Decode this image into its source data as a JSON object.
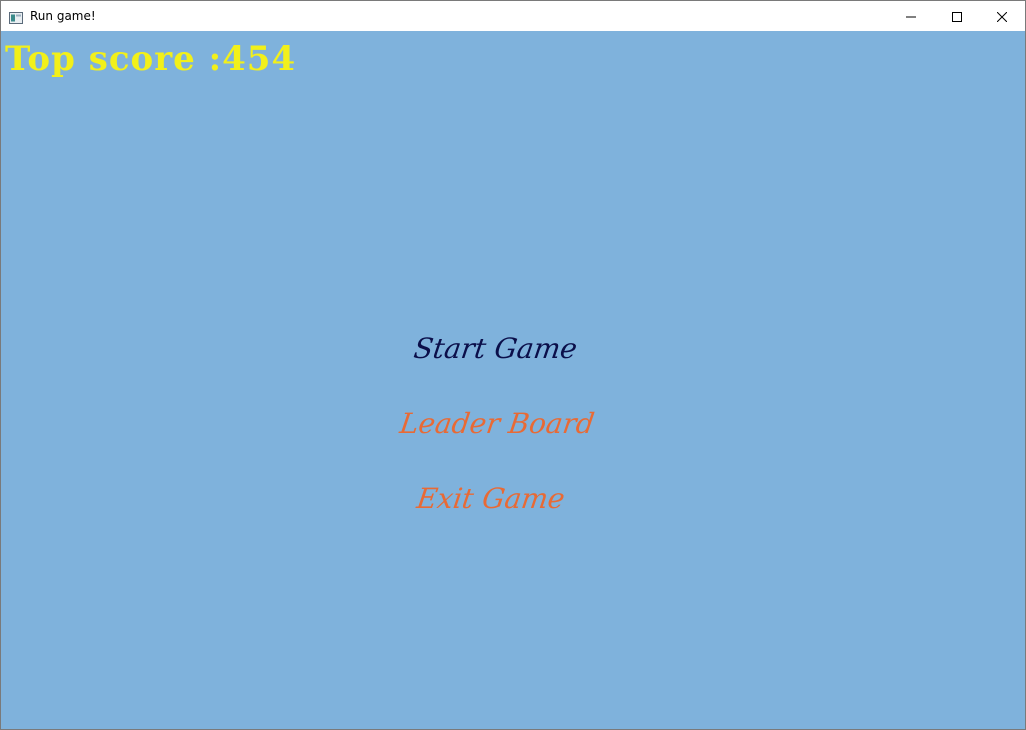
{
  "window": {
    "title": "Run game!",
    "controls": {
      "minimize_icon": "minimize-icon",
      "maximize_icon": "maximize-icon",
      "close_icon": "close-icon"
    }
  },
  "game": {
    "top_score_text": "Top score :454",
    "menu": {
      "start_label": "Start Game",
      "leaderboard_label": "Leader Board",
      "exit_label": "Exit Game"
    }
  },
  "colors": {
    "background": "#7fb2dc",
    "score": "#f2f01a",
    "menu_selected": "#0b0f4a",
    "menu_normal": "#e86a35"
  }
}
